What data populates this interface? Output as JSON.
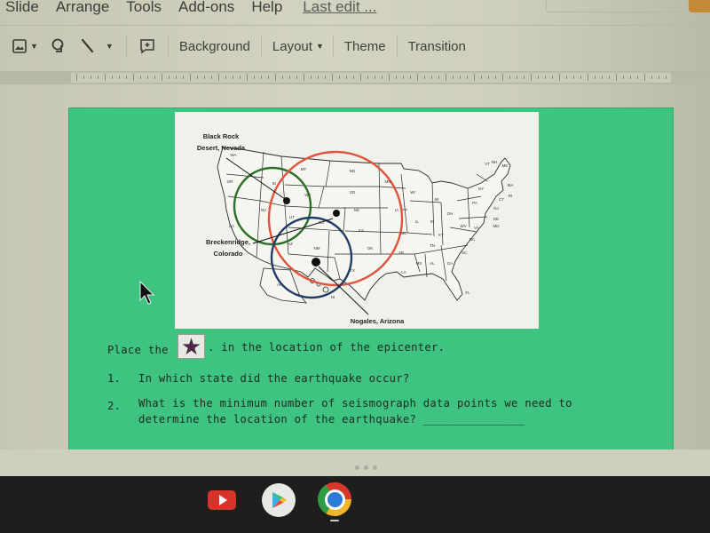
{
  "menubar": {
    "items": [
      "Slide",
      "Arrange",
      "Tools",
      "Add-ons",
      "Help"
    ],
    "last_edit": "Last edit ..."
  },
  "toolbar": {
    "icons": [
      "image-icon",
      "shape-icon",
      "line-icon",
      "comment-icon"
    ],
    "buttons": [
      "Background",
      "Layout",
      "Theme",
      "Transition"
    ]
  },
  "slide": {
    "background_color": "#3ec480",
    "map": {
      "labels": {
        "black_rock": [
          "Black Rock",
          "Desert, Nevada"
        ],
        "breckenridge": [
          "Breckenridge,",
          "Colorado"
        ],
        "nogales": "Nogales, Arizona"
      },
      "circles": [
        {
          "name": "Black Rock Desert, Nevada",
          "color": "#2c6e25"
        },
        {
          "name": "Breckenridge, Colorado",
          "color": "#e0533d"
        },
        {
          "name": "Nogales, Arizona",
          "color": "#1f3d66"
        }
      ],
      "state_labels": [
        "WA",
        "OR",
        "CA",
        "NV",
        "ID",
        "MT",
        "WY",
        "UT",
        "AZ",
        "CO",
        "NM",
        "ND",
        "SD",
        "NE",
        "KS",
        "OK",
        "TX",
        "MN",
        "IA",
        "MO",
        "AR",
        "LA",
        "WI",
        "IL",
        "MI",
        "IN",
        "OH",
        "KY",
        "TN",
        "MS",
        "AL",
        "GA",
        "FL",
        "SC",
        "NC",
        "VA",
        "WV",
        "PA",
        "NY",
        "VT",
        "NH",
        "ME",
        "MA",
        "RI",
        "CT",
        "NJ",
        "DE",
        "MD",
        "AK",
        "HI"
      ]
    },
    "instruction": {
      "before": "Place the",
      "after": ". in the location of the epicenter.",
      "star_icon": "star-icon",
      "star_color": "#4b2a45"
    },
    "questions": [
      {
        "number": "1.",
        "lines": [
          "In which state did the earthquake occur?"
        ]
      },
      {
        "number": "2.",
        "lines": [
          "What is the minimum number of seismograph data points we need to",
          "determine the location of the earthquake? _______________"
        ]
      }
    ]
  },
  "shelf": {
    "apps": [
      "YouTube",
      "Play Store",
      "Chrome"
    ]
  }
}
